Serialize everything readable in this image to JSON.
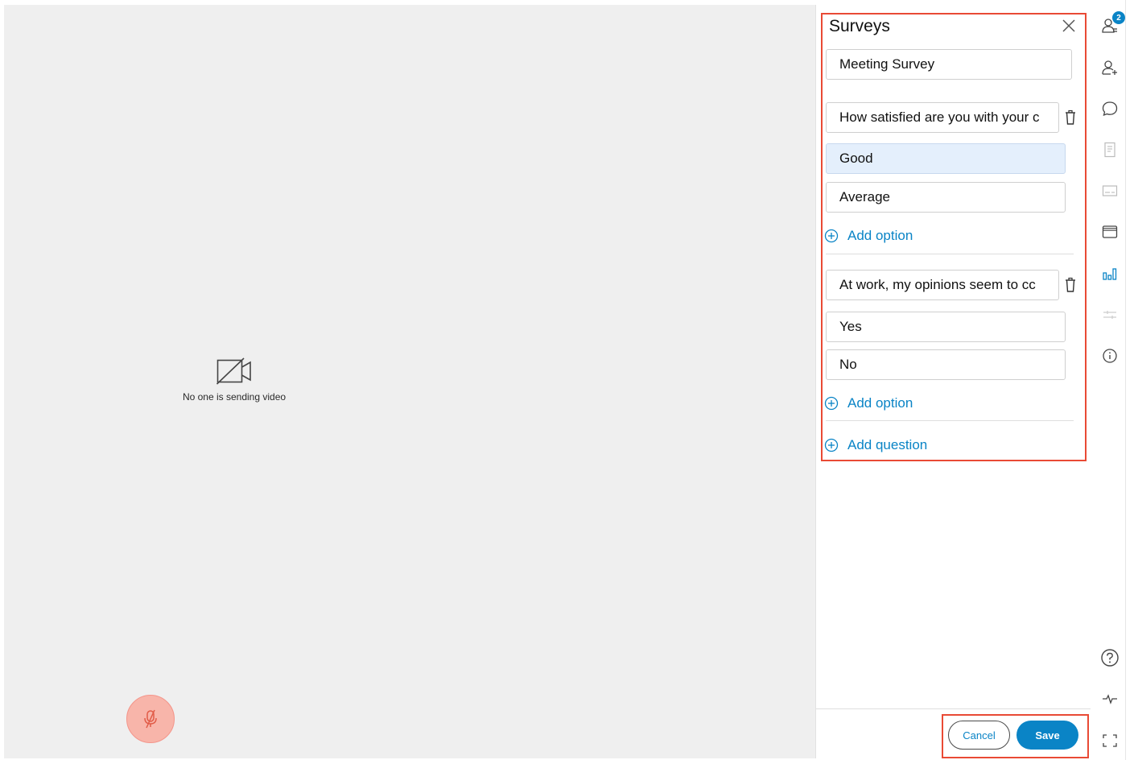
{
  "video": {
    "status_text": "No one is sending video"
  },
  "panel": {
    "title": "Surveys",
    "survey_name": "Meeting Survey",
    "questions": [
      {
        "text": "How satisfied are you with your c",
        "options": [
          "Good",
          "Average"
        ],
        "add_option_label": "Add option"
      },
      {
        "text": "At work, my opinions seem to cc",
        "options": [
          "Yes",
          "No"
        ],
        "add_option_label": "Add option"
      }
    ],
    "add_question_label": "Add question",
    "cancel_label": "Cancel",
    "save_label": "Save"
  },
  "rail": {
    "participants_badge": "2",
    "icons": [
      "participants-icon",
      "add-participant-icon",
      "chat-icon",
      "notes-icon",
      "captions-icon",
      "files-icon",
      "polls-icon",
      "settings-sliders-icon",
      "info-icon",
      "help-icon",
      "network-icon",
      "fullscreen-icon"
    ]
  },
  "colors": {
    "accent": "#0a84c6",
    "highlight_border": "#e94a35",
    "mute_button": "#f8b5aa",
    "selected_option_bg": "#e4effc"
  }
}
